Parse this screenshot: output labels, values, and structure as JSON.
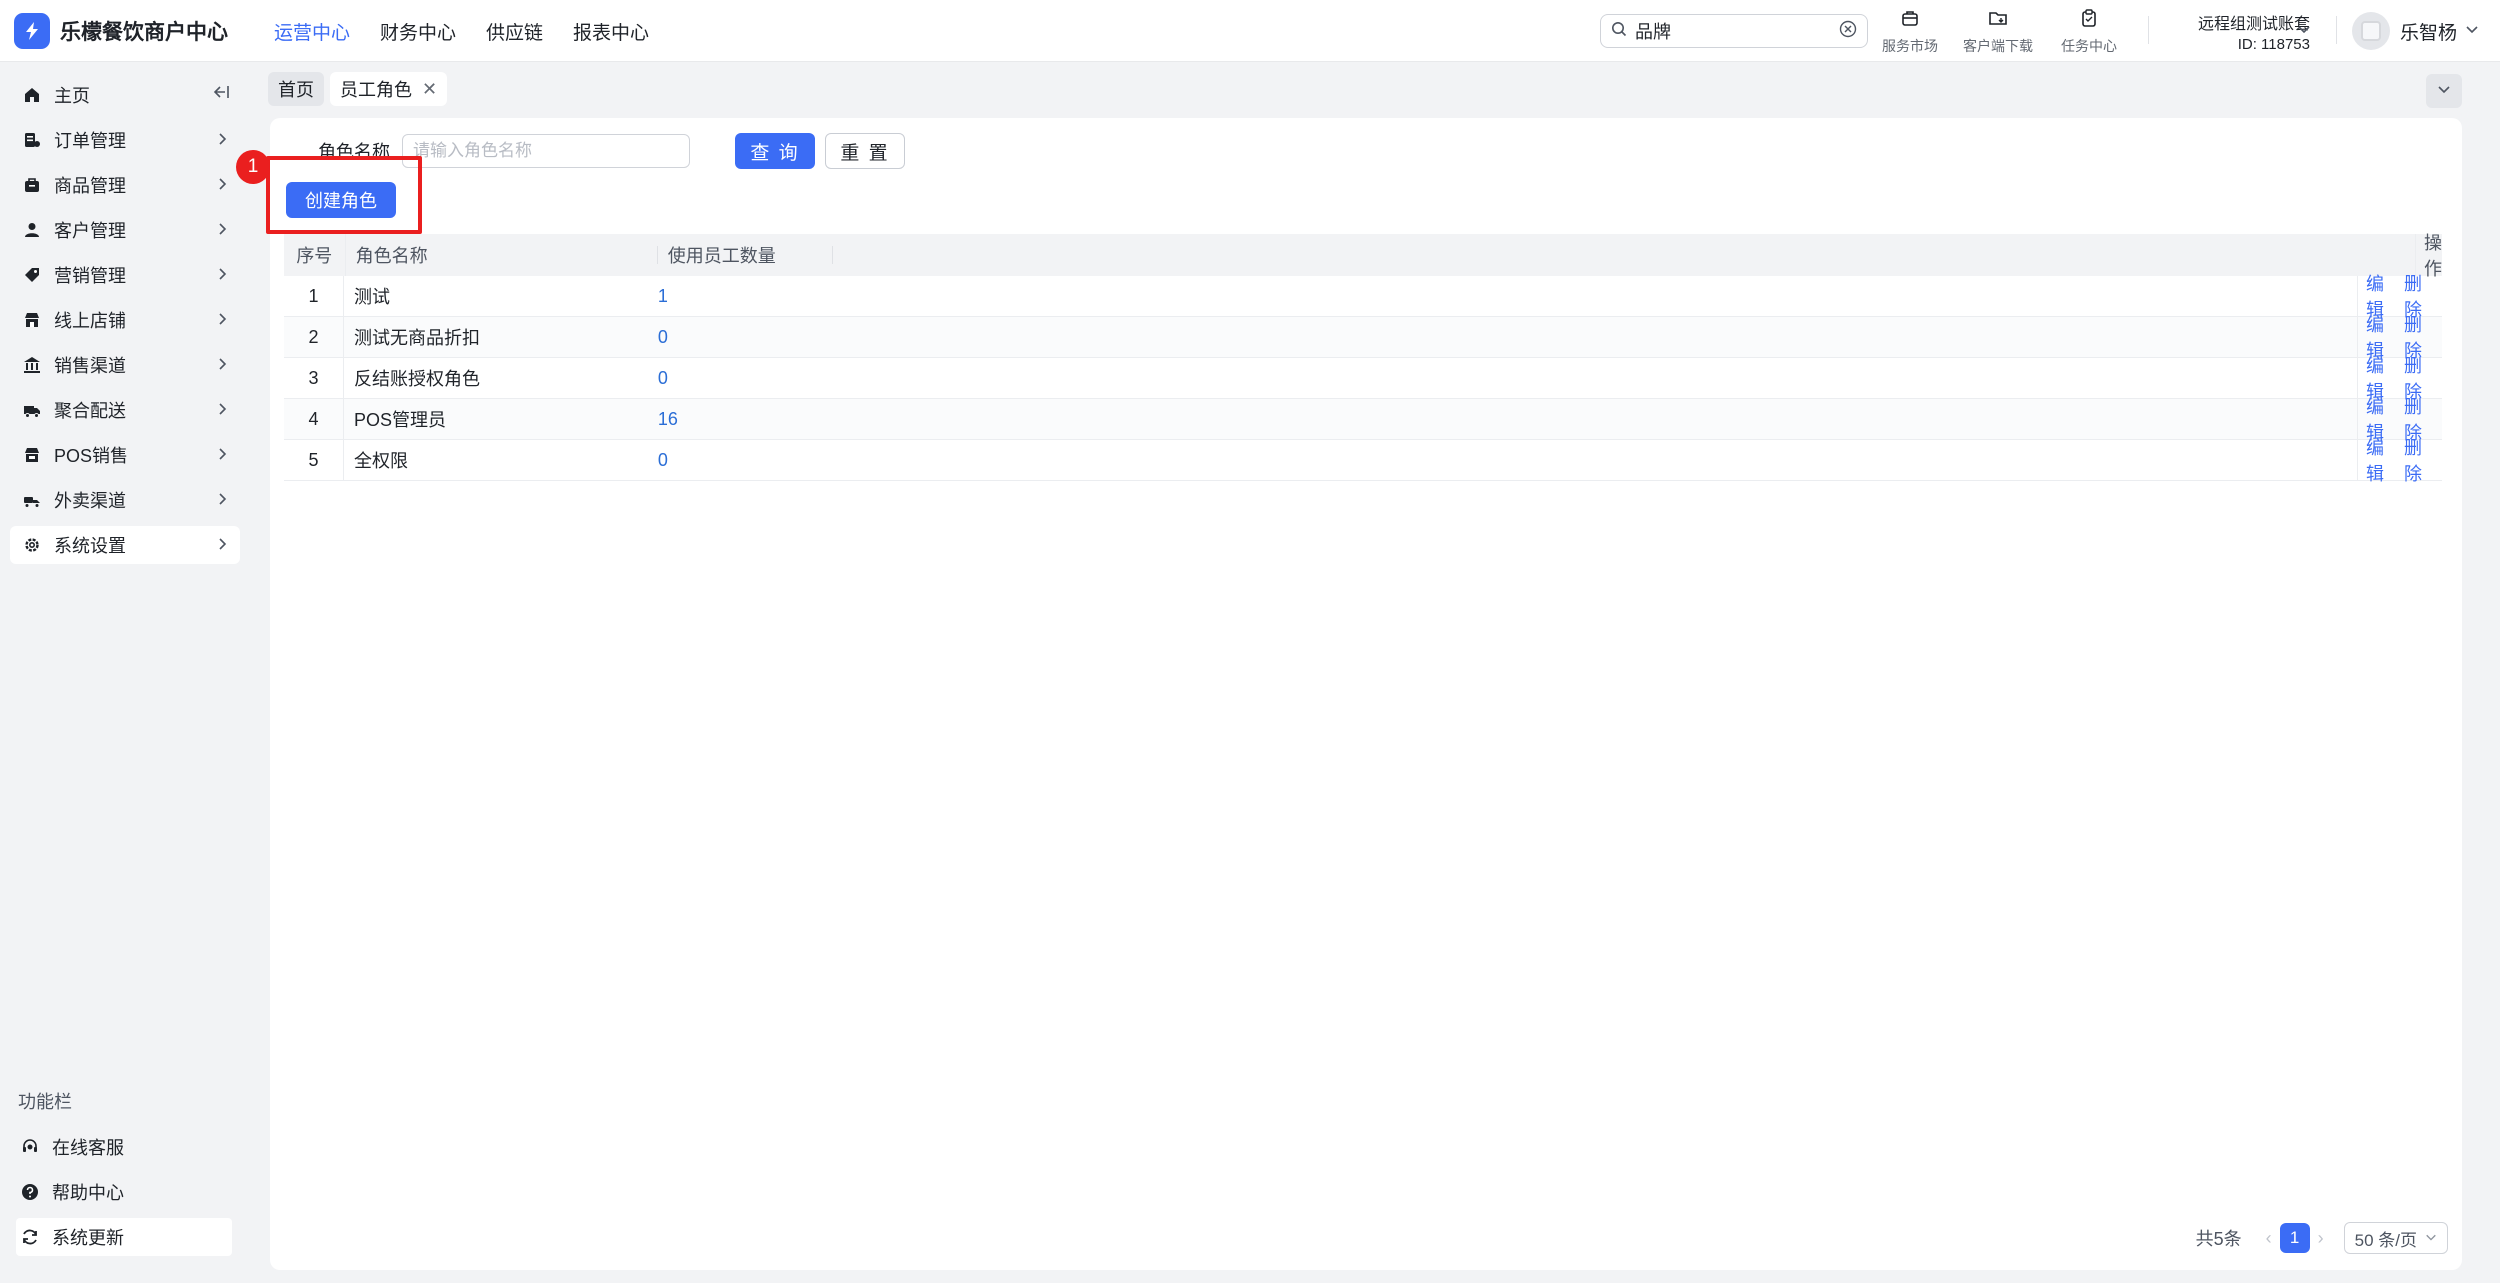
{
  "app": {
    "title": "乐檬餐饮商户中心"
  },
  "topnav": [
    "运营中心",
    "财务中心",
    "供应链",
    "报表中心"
  ],
  "search": {
    "value": "品牌"
  },
  "tools": [
    {
      "label": "服务市场",
      "icon": "shop-bag-icon"
    },
    {
      "label": "客户端下载",
      "icon": "folder-download-icon"
    },
    {
      "label": "任务中心",
      "icon": "clipboard-icon"
    }
  ],
  "account": {
    "name": "远程组测试账套",
    "id": "ID: 118753"
  },
  "user": {
    "name": "乐智杨"
  },
  "sidebar": {
    "items": [
      {
        "label": "主页",
        "icon": "home-icon"
      },
      {
        "label": "订单管理",
        "icon": "order-icon"
      },
      {
        "label": "商品管理",
        "icon": "product-icon"
      },
      {
        "label": "客户管理",
        "icon": "user-icon"
      },
      {
        "label": "营销管理",
        "icon": "tag-icon"
      },
      {
        "label": "线上店铺",
        "icon": "store-icon"
      },
      {
        "label": "销售渠道",
        "icon": "bank-icon"
      },
      {
        "label": "聚合配送",
        "icon": "delivery-truck-icon"
      },
      {
        "label": "POS销售",
        "icon": "pos-store-icon"
      },
      {
        "label": "外卖渠道",
        "icon": "scooter-icon"
      },
      {
        "label": "系统设置",
        "icon": "gear-icon"
      }
    ],
    "func_title": "功能栏",
    "func_items": [
      {
        "label": "在线客服",
        "icon": "headset-icon"
      },
      {
        "label": "帮助中心",
        "icon": "help-icon"
      },
      {
        "label": "系统更新",
        "icon": "refresh-icon"
      }
    ]
  },
  "tabs": {
    "home": "首页",
    "active": "员工角色"
  },
  "filter": {
    "label": "角色名称",
    "placeholder": "请输入角色名称",
    "query_button": "查 询",
    "reset_button": "重 置",
    "create_button": "创建角色"
  },
  "annotation": {
    "step": "1"
  },
  "table": {
    "headers": {
      "index": "序号",
      "name": "角色名称",
      "count": "使用员工数量",
      "ops": "操作"
    },
    "rows": [
      {
        "index": "1",
        "name": "测试",
        "count": "1"
      },
      {
        "index": "2",
        "name": "测试无商品折扣",
        "count": "0"
      },
      {
        "index": "3",
        "name": "反结账授权角色",
        "count": "0"
      },
      {
        "index": "4",
        "name": "POS管理员",
        "count": "16"
      },
      {
        "index": "5",
        "name": "全权限",
        "count": "0"
      }
    ],
    "edit_label": "编辑",
    "delete_label": "删除"
  },
  "pagination": {
    "total": "共5条",
    "current": "1",
    "page_size": "50 条/页"
  }
}
